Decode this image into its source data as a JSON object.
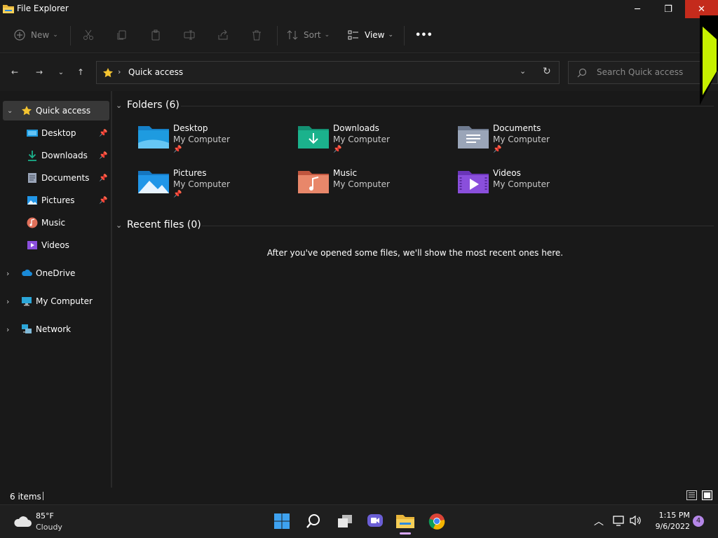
{
  "window": {
    "title": "File Explorer",
    "minimize_glyph": "─",
    "maximize_glyph": "❐",
    "close_glyph": "✕"
  },
  "toolbar": {
    "new_label": "New",
    "sort_label": "Sort",
    "view_label": "View",
    "more_label": "•••"
  },
  "address": {
    "path": "Quick access",
    "search_placeholder": "Search Quick access"
  },
  "sidebar": {
    "items": [
      {
        "label": "Quick access",
        "icon": "star-icon"
      },
      {
        "label": "Desktop",
        "icon": "desktop-folder-icon"
      },
      {
        "label": "Downloads",
        "icon": "download-icon"
      },
      {
        "label": "Documents",
        "icon": "documents-icon"
      },
      {
        "label": "Pictures",
        "icon": "pictures-icon"
      },
      {
        "label": "Music",
        "icon": "music-icon"
      },
      {
        "label": "Videos",
        "icon": "videos-icon"
      },
      {
        "label": "OneDrive",
        "icon": "cloud-icon"
      },
      {
        "label": "My Computer",
        "icon": "computer-icon"
      },
      {
        "label": "Network",
        "icon": "network-icon"
      }
    ]
  },
  "main": {
    "folders_heading": "Folders (6)",
    "recent_heading": "Recent files (0)",
    "empty_message": "After you've opened some files, we'll show the most recent ones here.",
    "folders": [
      {
        "name": "Desktop",
        "location": "My Computer",
        "pinned": true,
        "color": "#1e9be0"
      },
      {
        "name": "Downloads",
        "location": "My Computer",
        "pinned": true,
        "color": "#1bb28c"
      },
      {
        "name": "Documents",
        "location": "My Computer",
        "pinned": true,
        "color": "#8f9bb0"
      },
      {
        "name": "Pictures",
        "location": "My Computer",
        "pinned": true,
        "color": "#2196e8"
      },
      {
        "name": "Music",
        "location": "My Computer",
        "pinned": false,
        "color": "#e0705a"
      },
      {
        "name": "Videos",
        "location": "My Computer",
        "pinned": false,
        "color": "#8a4fdc"
      }
    ]
  },
  "status": {
    "item_count": "6 items"
  },
  "taskbar": {
    "weather_temp": "85°F",
    "weather_desc": "Cloudy",
    "time": "1:15 PM",
    "date": "9/6/2022",
    "notification_count": "4"
  },
  "colors": {
    "close_button": "#c42b1c",
    "accent_star": "#f4c430",
    "cursor": "#c6f000"
  }
}
